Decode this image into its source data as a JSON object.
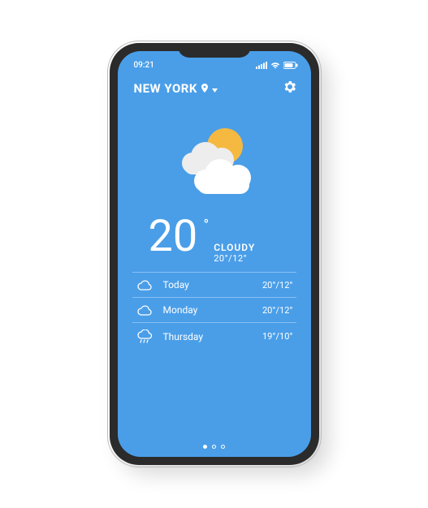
{
  "status": {
    "time": "09:21"
  },
  "location": {
    "city": "NEW YORK"
  },
  "current": {
    "temp": "20",
    "condition": "CLOUDY",
    "range": "20°/12°"
  },
  "forecast": [
    {
      "day": "Today",
      "range": "20°/12°",
      "icon": "cloud"
    },
    {
      "day": "Monday",
      "range": "20°/12°",
      "icon": "cloud"
    },
    {
      "day": "Thursday",
      "range": "19°/10°",
      "icon": "rain"
    }
  ],
  "pager": {
    "count": 3,
    "active": 0
  }
}
